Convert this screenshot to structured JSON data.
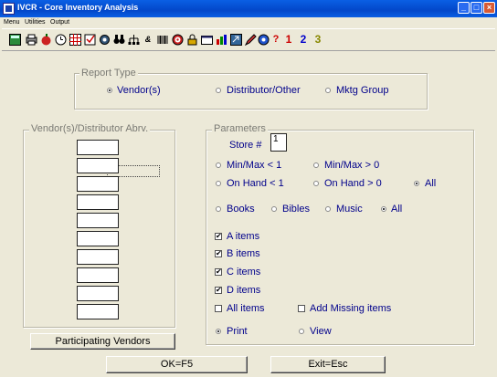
{
  "window": {
    "title": "IVCR - Core Inventory Analysis",
    "min": "_",
    "max": "□",
    "close": "×"
  },
  "menu": {
    "items": [
      "Menu",
      "Utilities",
      "Output"
    ]
  },
  "toolbar": {
    "icons": [
      "calculator-icon",
      "print-icon",
      "apple-icon",
      "clock-icon",
      "grid-icon",
      "check-icon",
      "settings-icon",
      "binoculars-icon",
      "tree-icon",
      "text-icon",
      "barcode-icon",
      "target-icon",
      "lock-icon",
      "window-icon",
      "chart-icon",
      "export-icon",
      "pen-icon",
      "circle-icon",
      "help-icon"
    ],
    "btn1": "1",
    "btn2": "2",
    "btn3": "3",
    "help": "?"
  },
  "report_type": {
    "legend": "Report Type",
    "options": [
      "Vendor(s)",
      "Distributor/Other",
      "Mktg Group"
    ],
    "selected": "Vendor(s)"
  },
  "vendor_list": {
    "legend": "Vendor(s)/Distributor Abrv.",
    "cells": [
      "",
      "",
      "",
      "",
      "",
      "",
      "",
      "",
      "",
      ""
    ]
  },
  "parameters": {
    "legend": "Parameters",
    "store_label": "Store #",
    "store_value": "1",
    "minmax_lt": "Min/Max < 1",
    "minmax_gt": "Min/Max > 0",
    "onhand_lt": "On Hand < 1",
    "onhand_gt": "On Hand > 0",
    "all1": "All",
    "books": "Books",
    "bibles": "Bibles",
    "music": "Music",
    "all2": "All",
    "a_items": "A items",
    "b_items": "B items",
    "c_items": "C items",
    "d_items": "D items",
    "all_items": "All items",
    "add_missing": "Add Missing items",
    "print": "Print",
    "view": "View",
    "check_mark": "✔"
  },
  "buttons": {
    "participating": "Participating Vendors",
    "ok": "OK=F5",
    "exit": "Exit=Esc"
  }
}
